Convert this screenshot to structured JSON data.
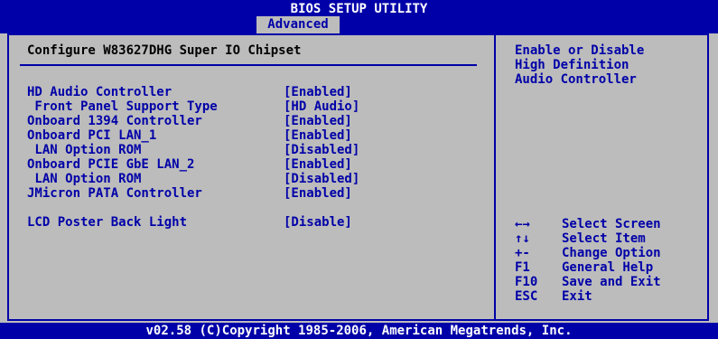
{
  "header": {
    "title": "BIOS SETUP UTILITY",
    "active_tab": "Advanced"
  },
  "main": {
    "heading": "Configure W83627DHG Super IO Chipset",
    "options": [
      {
        "label": "HD Audio Controller",
        "value": "[Enabled]"
      },
      {
        "label": " Front Panel Support Type",
        "value": "[HD Audio]"
      },
      {
        "label": "Onboard 1394 Controller",
        "value": "[Enabled]"
      },
      {
        "label": "Onboard PCI LAN_1",
        "value": "[Enabled]"
      },
      {
        "label": " LAN Option ROM",
        "value": "[Disabled]"
      },
      {
        "label": "Onboard PCIE GbE LAN_2",
        "value": "[Enabled]"
      },
      {
        "label": " LAN Option ROM",
        "value": "[Disabled]"
      },
      {
        "label": "JMicron PATA Controller",
        "value": "[Enabled]"
      },
      {
        "label": "LCD Poster Back Light",
        "value": "[Disable]"
      }
    ]
  },
  "help": {
    "line1": "Enable or Disable",
    "line2": "High Definition",
    "line3": "Audio Controller"
  },
  "keys": [
    {
      "key": "←→",
      "desc": "Select Screen",
      "icon": "left-right-arrows-icon"
    },
    {
      "key": "↑↓",
      "desc": "Select Item",
      "icon": "up-down-arrows-icon"
    },
    {
      "key": "+-",
      "desc": "Change Option"
    },
    {
      "key": "F1",
      "desc": "General Help"
    },
    {
      "key": "F10",
      "desc": "Save and Exit"
    },
    {
      "key": "ESC",
      "desc": "Exit"
    }
  ],
  "footer": {
    "copyright": "v02.58 (C)Copyright 1985-2006, American Megatrends, Inc."
  },
  "colors": {
    "background": "#bcbcbc",
    "accent": "#0000a8",
    "text_dark": "#000000",
    "text_light": "#ffffff"
  }
}
